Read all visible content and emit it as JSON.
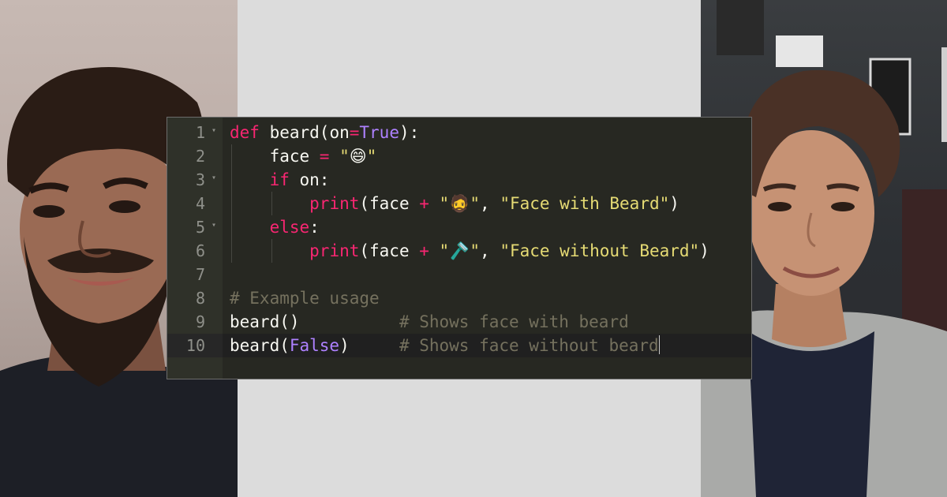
{
  "editor": {
    "lines": [
      {
        "num": "1",
        "fold": "▾",
        "tokens": [
          [
            "kw",
            "def"
          ],
          [
            "pl",
            " beard(on"
          ],
          [
            "op",
            "="
          ],
          [
            "const",
            "True"
          ],
          [
            "pl",
            "):"
          ]
        ]
      },
      {
        "num": "2",
        "fold": "",
        "tokens": [
          [
            "pl",
            "    face "
          ],
          [
            "op",
            "="
          ],
          [
            "pl",
            " "
          ],
          [
            "str",
            "\""
          ],
          [
            "emoji",
            "😄"
          ],
          [
            "str",
            "\""
          ]
        ]
      },
      {
        "num": "3",
        "fold": "▾",
        "tokens": [
          [
            "pl",
            "    "
          ],
          [
            "kw",
            "if"
          ],
          [
            "pl",
            " on:"
          ]
        ]
      },
      {
        "num": "4",
        "fold": "",
        "tokens": [
          [
            "pl",
            "        "
          ],
          [
            "fn",
            "print"
          ],
          [
            "pl",
            "(face "
          ],
          [
            "op",
            "+"
          ],
          [
            "pl",
            " "
          ],
          [
            "str",
            "\""
          ],
          [
            "emoji",
            "🧔"
          ],
          [
            "str",
            "\""
          ],
          [
            "pl",
            ", "
          ],
          [
            "str",
            "\"Face with Beard\""
          ],
          [
            "pl",
            ")"
          ]
        ]
      },
      {
        "num": "5",
        "fold": "▾",
        "tokens": [
          [
            "pl",
            "    "
          ],
          [
            "kw",
            "else"
          ],
          [
            "pl",
            ":"
          ]
        ]
      },
      {
        "num": "6",
        "fold": "",
        "tokens": [
          [
            "pl",
            "        "
          ],
          [
            "fn",
            "print"
          ],
          [
            "pl",
            "(face "
          ],
          [
            "op",
            "+"
          ],
          [
            "pl",
            " "
          ],
          [
            "str",
            "\""
          ],
          [
            "emoji",
            "🪒"
          ],
          [
            "str",
            "\""
          ],
          [
            "pl",
            ", "
          ],
          [
            "str",
            "\"Face without Beard\""
          ],
          [
            "pl",
            ")"
          ]
        ]
      },
      {
        "num": "7",
        "fold": "",
        "tokens": []
      },
      {
        "num": "8",
        "fold": "",
        "tokens": [
          [
            "cm",
            "# Example usage"
          ]
        ]
      },
      {
        "num": "9",
        "fold": "",
        "tokens": [
          [
            "pl",
            "beard()          "
          ],
          [
            "cm",
            "# Shows face with beard"
          ]
        ]
      },
      {
        "num": "10",
        "fold": "",
        "tokens": [
          [
            "pl",
            "beard("
          ],
          [
            "const",
            "False"
          ],
          [
            "pl",
            ")     "
          ],
          [
            "cm",
            "# Shows face without beard"
          ]
        ],
        "active": true
      }
    ]
  },
  "colors": {
    "editor_bg": "#272822",
    "keyword": "#f92672",
    "constant": "#ae81ff",
    "string": "#e6db74",
    "comment": "#75715e",
    "plain": "#f8f8f2",
    "line_number": "#8f908a"
  },
  "photos": {
    "left": "person-with-beard-photo",
    "right": "person-without-beard-photo"
  }
}
